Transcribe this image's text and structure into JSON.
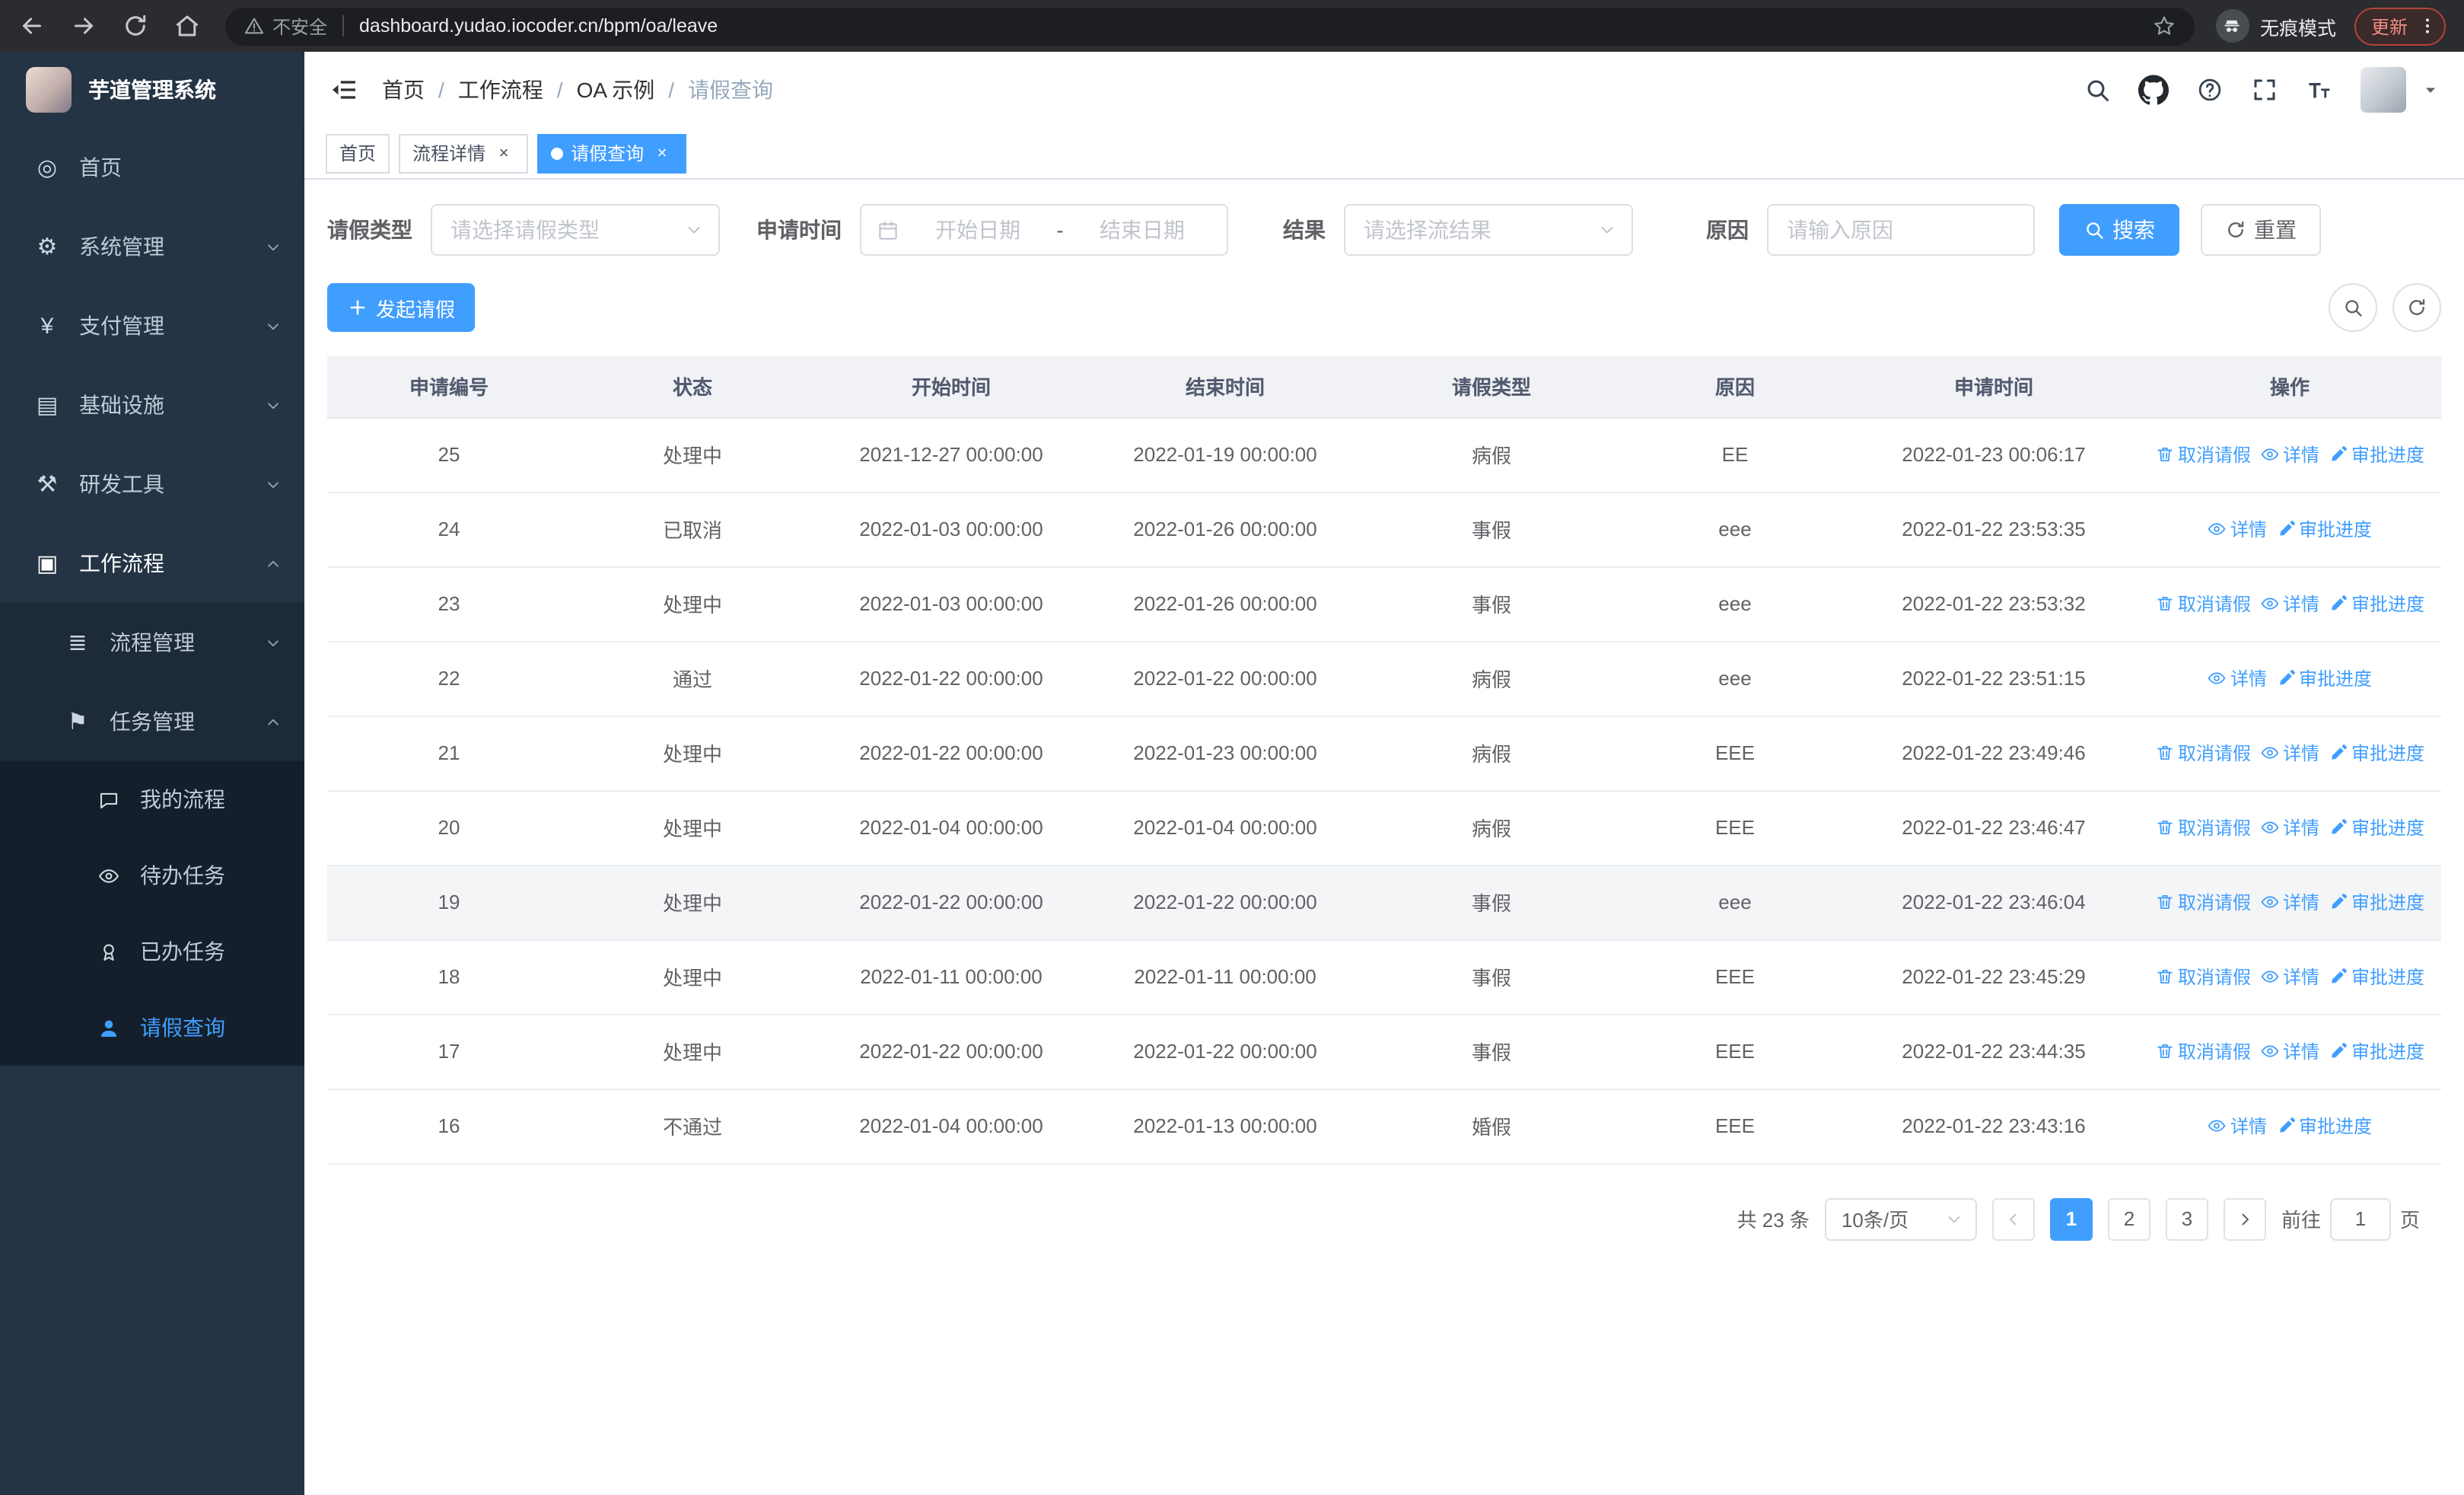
{
  "browser": {
    "security_label": "不安全",
    "url": "dashboard.yudao.iocoder.cn/bpm/oa/leave",
    "incognito_label": "无痕模式",
    "update_label": "更新"
  },
  "ui": {
    "close": "×"
  },
  "colors": {
    "primary": "#409eff",
    "chrome_bg": "#2b2c2f",
    "urlbar_bg": "#1d1e21",
    "update_accent": "#f28b82",
    "sidebar_bg": "#253444",
    "sidebar_submenu_bg": "#1d2a38",
    "sidebar_leaf_bg": "#141f2b",
    "table_header_bg": "#f0f2f5",
    "row_hover_bg": "#f4f5f7"
  },
  "sidebar": {
    "logo_title": "芋道管理系统",
    "items": [
      {
        "label": "首页",
        "icon": "dashboard-icon"
      },
      {
        "label": "系统管理",
        "icon": "gear-icon"
      },
      {
        "label": "支付管理",
        "icon": "yen-icon"
      },
      {
        "label": "基础设施",
        "icon": "monitor-icon"
      },
      {
        "label": "研发工具",
        "icon": "toolbox-icon"
      },
      {
        "label": "工作流程",
        "icon": "briefcase-icon",
        "expanded": true
      }
    ],
    "submenu": [
      {
        "label": "流程管理",
        "icon": "list-icon"
      },
      {
        "label": "任务管理",
        "icon": "flag-icon",
        "expanded": true
      }
    ],
    "leaf_items": [
      {
        "label": "我的流程",
        "icon": "chat-icon"
      },
      {
        "label": "待办任务",
        "icon": "eye-icon"
      },
      {
        "label": "已办任务",
        "icon": "medal-icon"
      },
      {
        "label": "请假查询",
        "icon": "person-icon",
        "active": true
      }
    ]
  },
  "header": {
    "separator": "/",
    "breadcrumb": [
      "首页",
      "工作流程",
      "OA 示例",
      "请假查询"
    ]
  },
  "tabs": [
    {
      "label": "首页",
      "closable": false,
      "active": false
    },
    {
      "label": "流程详情",
      "closable": true,
      "active": false
    },
    {
      "label": "请假查询",
      "closable": true,
      "active": true
    }
  ],
  "filters": {
    "leave_type_label": "请假类型",
    "leave_type_placeholder": "请选择请假类型",
    "apply_time_label": "申请时间",
    "start_date_placeholder": "开始日期",
    "date_separator": "-",
    "end_date_placeholder": "结束日期",
    "result_label": "结果",
    "result_placeholder": "请选择流结果",
    "reason_label": "原因",
    "reason_placeholder": "请输入原因",
    "search_button": "搜索",
    "reset_button": "重置"
  },
  "toolbar": {
    "create_button": "发起请假"
  },
  "table": {
    "columns": [
      "申请编号",
      "状态",
      "开始时间",
      "结束时间",
      "请假类型",
      "原因",
      "申请时间",
      "操作"
    ],
    "actions": {
      "cancel": "取消请假",
      "detail": "详情",
      "progress": "审批进度"
    },
    "rows": [
      {
        "id": "25",
        "status": "处理中",
        "start": "2021-12-27 00:00:00",
        "end": "2022-01-19 00:00:00",
        "type": "病假",
        "reason": "EE",
        "applied": "2022-01-23 00:06:17",
        "can_cancel": true,
        "highlighted": false
      },
      {
        "id": "24",
        "status": "已取消",
        "start": "2022-01-03 00:00:00",
        "end": "2022-01-26 00:00:00",
        "type": "事假",
        "reason": "eee",
        "applied": "2022-01-22 23:53:35",
        "can_cancel": false,
        "highlighted": false
      },
      {
        "id": "23",
        "status": "处理中",
        "start": "2022-01-03 00:00:00",
        "end": "2022-01-26 00:00:00",
        "type": "事假",
        "reason": "eee",
        "applied": "2022-01-22 23:53:32",
        "can_cancel": true,
        "highlighted": false
      },
      {
        "id": "22",
        "status": "通过",
        "start": "2022-01-22 00:00:00",
        "end": "2022-01-22 00:00:00",
        "type": "病假",
        "reason": "eee",
        "applied": "2022-01-22 23:51:15",
        "can_cancel": false,
        "highlighted": false
      },
      {
        "id": "21",
        "status": "处理中",
        "start": "2022-01-22 00:00:00",
        "end": "2022-01-23 00:00:00",
        "type": "病假",
        "reason": "EEE",
        "applied": "2022-01-22 23:49:46",
        "can_cancel": true,
        "highlighted": false
      },
      {
        "id": "20",
        "status": "处理中",
        "start": "2022-01-04 00:00:00",
        "end": "2022-01-04 00:00:00",
        "type": "病假",
        "reason": "EEE",
        "applied": "2022-01-22 23:46:47",
        "can_cancel": true,
        "highlighted": false
      },
      {
        "id": "19",
        "status": "处理中",
        "start": "2022-01-22 00:00:00",
        "end": "2022-01-22 00:00:00",
        "type": "事假",
        "reason": "eee",
        "applied": "2022-01-22 23:46:04",
        "can_cancel": true,
        "highlighted": true
      },
      {
        "id": "18",
        "status": "处理中",
        "start": "2022-01-11 00:00:00",
        "end": "2022-01-11 00:00:00",
        "type": "事假",
        "reason": "EEE",
        "applied": "2022-01-22 23:45:29",
        "can_cancel": true,
        "highlighted": false
      },
      {
        "id": "17",
        "status": "处理中",
        "start": "2022-01-22 00:00:00",
        "end": "2022-01-22 00:00:00",
        "type": "事假",
        "reason": "EEE",
        "applied": "2022-01-22 23:44:35",
        "can_cancel": true,
        "highlighted": false
      },
      {
        "id": "16",
        "status": "不通过",
        "start": "2022-01-04 00:00:00",
        "end": "2022-01-13 00:00:00",
        "type": "婚假",
        "reason": "EEE",
        "applied": "2022-01-22 23:43:16",
        "can_cancel": false,
        "highlighted": false
      }
    ]
  },
  "pagination": {
    "total_text": "共 23 条",
    "page_size": "10条/页",
    "pages": [
      "1",
      "2",
      "3"
    ],
    "active_page": "1",
    "goto_label": "前往",
    "goto_value": "1",
    "goto_suffix": "页"
  }
}
